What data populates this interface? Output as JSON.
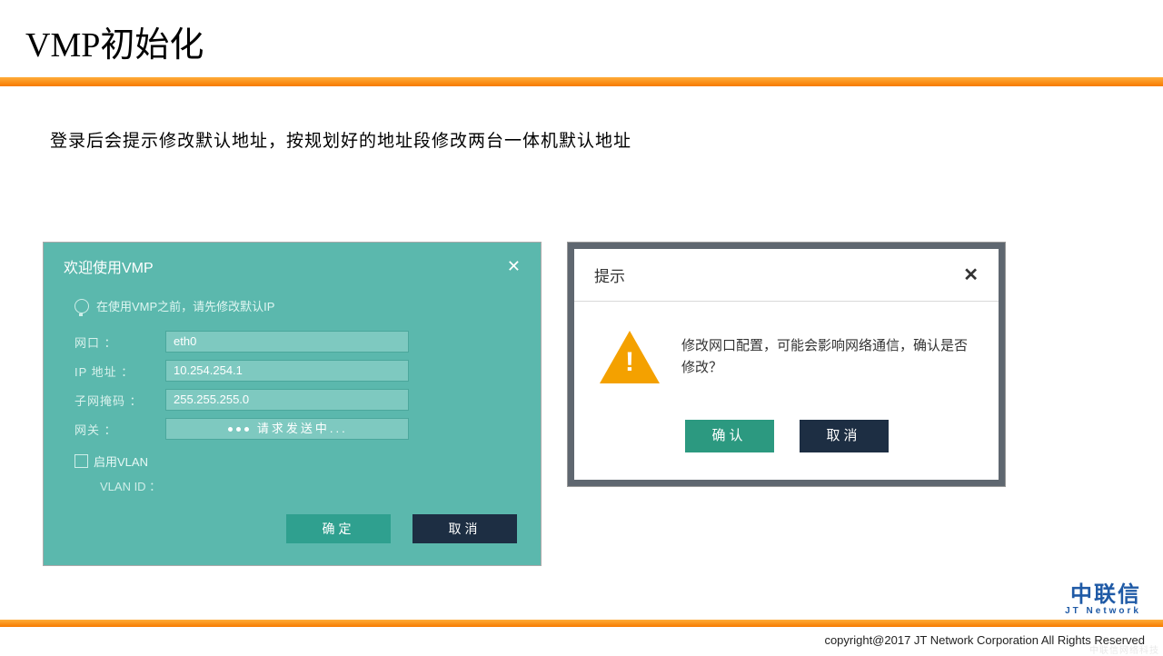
{
  "slide": {
    "title": "VMP初始化",
    "body": "登录后会提示修改默认地址，按规划好的地址段修改两台一体机默认地址"
  },
  "vmp": {
    "header": "欢迎使用VMP",
    "close": "✕",
    "tip": "在使用VMP之前，请先修改默认IP",
    "fields": {
      "port_label": "网口 ：",
      "port_value": "eth0",
      "ip_label": "IP 地址 ：",
      "ip_value": "10.254.254.1",
      "mask_label": "子网掩码 ：",
      "mask_value": "255.255.255.0",
      "gw_label": "网关 ：",
      "gw_loading": "请求发送中...",
      "vlan_enable": "启用VLAN",
      "vlan_id_label": "VLAN ID ："
    },
    "btn_ok": "确定",
    "btn_cancel": "取消"
  },
  "confirm": {
    "title": "提示",
    "close": "✕",
    "warn_mark": "!",
    "message": "修改网口配置，可能会影响网络通信，确认是否修改？",
    "btn_ok": "确认",
    "btn_cancel": "取消"
  },
  "footer": {
    "logo_cn": "中联信",
    "logo_en": "JT Network",
    "copyright": "copyright@2017  JT Network Corporation All Rights Reserved",
    "watermark": "中联信网络科技"
  }
}
